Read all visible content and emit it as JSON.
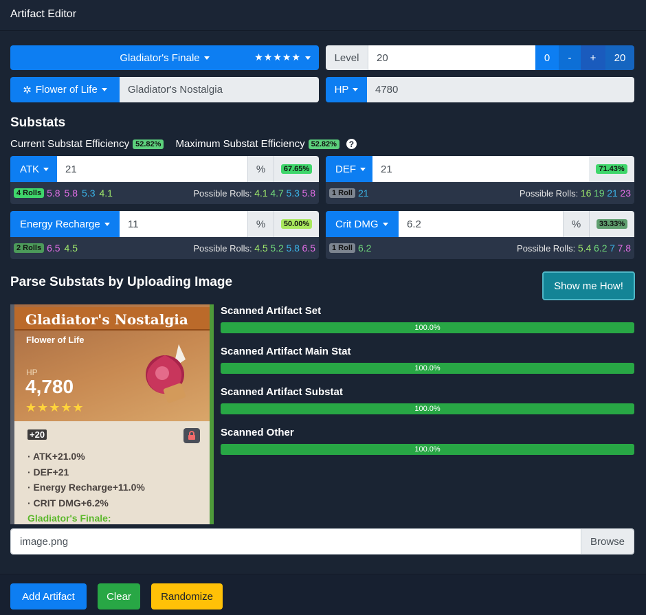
{
  "header": {
    "title": "Artifact Editor"
  },
  "set": {
    "name": "Gladiator's Finale",
    "stars": "★★★★★"
  },
  "level": {
    "label": "Level",
    "value": "20",
    "btn_zero": "0",
    "btn_minus": "-",
    "btn_plus": "+",
    "btn_max": "20"
  },
  "slot": {
    "label": "Flower of Life",
    "piece_name": "Gladiator's Nostalgia"
  },
  "mainstat": {
    "label": "HP",
    "value": "4780"
  },
  "substats": {
    "title": "Substats",
    "current_label": "Current Substat Efficiency",
    "current_value": "52.82%",
    "max_label": "Maximum Substat Efficiency",
    "max_value": "52.82%",
    "help": "?",
    "items": [
      {
        "name": "ATK",
        "value": "21",
        "pct": "%",
        "eff": "67.65%",
        "rolls": "4 Rolls",
        "roll_vals": [
          "5.8",
          "5.8",
          "5.3",
          "4.1"
        ],
        "possible_label": "Possible Rolls:",
        "possible": [
          "4.1",
          "4.7",
          "5.3",
          "5.8"
        ]
      },
      {
        "name": "DEF",
        "value": "21",
        "pct": "",
        "eff": "71.43%",
        "rolls": "1 Roll",
        "roll_vals": [
          "21"
        ],
        "possible_label": "Possible Rolls:",
        "possible": [
          "16",
          "19",
          "21",
          "23"
        ]
      },
      {
        "name": "Energy Recharge",
        "value": "11",
        "pct": "%",
        "eff": "50.00%",
        "rolls": "2 Rolls",
        "roll_vals": [
          "6.5",
          "4.5"
        ],
        "possible_label": "Possible Rolls:",
        "possible": [
          "4.5",
          "5.2",
          "5.8",
          "6.5"
        ]
      },
      {
        "name": "Crit DMG",
        "value": "6.2",
        "pct": "%",
        "eff": "33.33%",
        "rolls": "1 Roll",
        "roll_vals": [
          "6.2"
        ],
        "possible_label": "Possible Rolls:",
        "possible": [
          "5.4",
          "6.2",
          "7",
          "7.8"
        ]
      }
    ]
  },
  "parse": {
    "title": "Parse Substats by Uploading Image",
    "help_button": "Show me How!",
    "image": {
      "title": "Gladiator's Nostalgia",
      "slot": "Flower of Life",
      "stat_name": "HP",
      "stat_value": "4,780",
      "stars": "★★★★★",
      "level": "+20",
      "lines": [
        "· ATK+21.0%",
        "· DEF+21",
        "· Energy Recharge+11.0%",
        "· CRIT DMG+6.2%"
      ],
      "set_name": "Gladiator's Finale:"
    },
    "bars": [
      {
        "label": "Scanned Artifact Set",
        "progress": 100,
        "text": "100.0%"
      },
      {
        "label": "Scanned Artifact Main Stat",
        "progress": 100,
        "text": "100.0%"
      },
      {
        "label": "Scanned Artifact Substat",
        "progress": 100,
        "text": "100.0%"
      },
      {
        "label": "Scanned Other",
        "progress": 100,
        "text": "100.0%"
      }
    ],
    "file_value": "image.png",
    "browse": "Browse"
  },
  "footer": {
    "add": "Add Artifact",
    "clear": "Clear",
    "randomize": "Randomize"
  },
  "colors": {
    "primary": "#0d7ef2",
    "success": "#28a745",
    "warning": "#ffc107",
    "info": "#17a2b8",
    "bg": "#1a2433"
  }
}
